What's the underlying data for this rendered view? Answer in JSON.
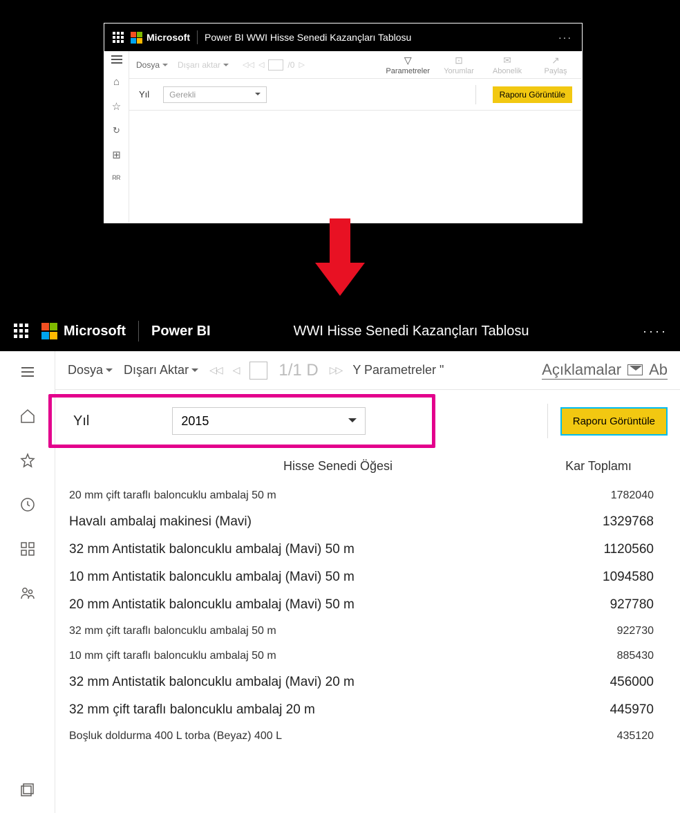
{
  "top": {
    "brand": "Microsoft",
    "product_and_title": "Power BI WWI Hisse Senedi Kazançları Tablosu",
    "ellipsis": "···",
    "toolbar": {
      "file": "Dosya",
      "export": "Dışarı aktar",
      "page_frac": "/0",
      "filters": "Parametreler",
      "comments": "Yorumlar",
      "subscribe": "Abonelik",
      "share": "Paylaş"
    },
    "param": {
      "label": "Yıl",
      "placeholder": "Gerekli",
      "button": "Raporu Görüntüle"
    }
  },
  "bottom": {
    "brand": "Microsoft",
    "product": "Power BI",
    "title": "WWI Hisse Senedi Kazançları Tablosu",
    "ellipsis": "····",
    "toolbar": {
      "file": "Dosya",
      "export": "Dışarı Aktar",
      "page_text": "1/1 D",
      "params": "Y Parametreler \"",
      "explain": "Açıklamalar",
      "ab": "Ab"
    },
    "param": {
      "label": "Yıl",
      "value": "2015",
      "button": "Raporu Görüntüle"
    },
    "table": {
      "col_item": "Hisse Senedi Öğesi",
      "col_profit": "Kar Toplamı",
      "rows": [
        {
          "item": "20 mm çift taraflı baloncuklu ambalaj 50 m",
          "profit": "1782040",
          "thin": true
        },
        {
          "item": "Havalı ambalaj makinesi (Mavi)",
          "profit": "1329768",
          "thin": false
        },
        {
          "item": "32 mm Antistatik baloncuklu ambalaj (Mavi) 50 m",
          "profit": "1120560",
          "thin": false
        },
        {
          "item": "10 mm Antistatik baloncuklu ambalaj (Mavi) 50 m",
          "profit": "1094580",
          "thin": false
        },
        {
          "item": "20 mm Antistatik baloncuklu ambalaj (Mavi) 50 m",
          "profit": "927780",
          "thin": false
        },
        {
          "item": "32 mm çift taraflı baloncuklu ambalaj 50 m",
          "profit": "922730",
          "thin": true
        },
        {
          "item": "10 mm çift taraflı baloncuklu ambalaj 50 m",
          "profit": "885430",
          "thin": true
        },
        {
          "item": "32 mm Antistatik baloncuklu ambalaj (Mavi) 20 m",
          "profit": "456000",
          "thin": false
        },
        {
          "item": "32 mm çift taraflı baloncuklu ambalaj 20 m",
          "profit": "445970",
          "thin": false
        },
        {
          "item": "Boşluk doldurma 400 L torba (Beyaz) 400 L",
          "profit": "435120",
          "thin": true
        }
      ]
    }
  },
  "icons": {
    "filter": "▽",
    "comment": "💬",
    "mail": "✉",
    "share": "↗",
    "star": "☆",
    "refresh": "↻",
    "grid": "▦",
    "people": "👥",
    "home": "⌂",
    "clock": "◷",
    "stack": "🗇"
  }
}
